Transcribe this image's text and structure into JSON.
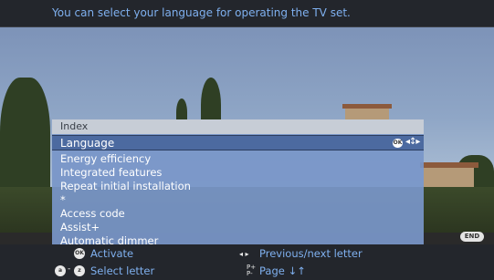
{
  "info_banner": {
    "text": "You can select your language for operating the TV set."
  },
  "menu": {
    "header": "Index",
    "selected": {
      "label": "Language",
      "ok_badge": "OK",
      "nav_icon": "◂↕▸"
    },
    "items": [
      {
        "label": "Energy efficiency"
      },
      {
        "label": "Integrated features"
      },
      {
        "label": "Repeat initial installation"
      },
      {
        "label": "*"
      },
      {
        "label": "Access code"
      },
      {
        "label": "Assist+"
      },
      {
        "label": "Automatic dimmer"
      }
    ]
  },
  "end_button": {
    "label": "END"
  },
  "help_bar": {
    "activate": {
      "icon_text": "OK",
      "label": "Activate"
    },
    "prev_next": {
      "icon": "◂ ▸",
      "label": "Previous/next letter"
    },
    "select_letter": {
      "icon_from": "a",
      "separator": "-",
      "icon_to": "z",
      "label": "Select letter"
    },
    "page": {
      "icon_top": "P+",
      "icon_bottom": "P-",
      "label": "Page ↓↑"
    }
  },
  "colors": {
    "accent_text": "#7fb0ef",
    "menu_bg": "#7896c8",
    "menu_selected": "#4c6aa0",
    "bar_bg": "#23262c"
  }
}
